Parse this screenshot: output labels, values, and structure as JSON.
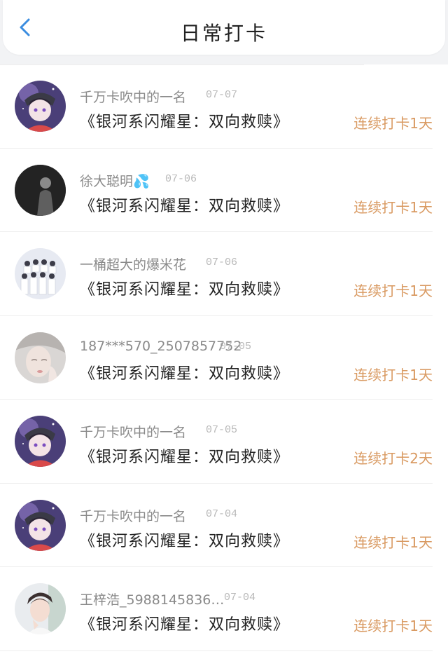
{
  "header": {
    "title": "日常打卡",
    "back_icon": "chevron-left-icon",
    "accent_color": "#3b8de0"
  },
  "checkins": [
    {
      "user": "千万卡吹中的一名",
      "date": "07-07",
      "book": "《银河系闪耀星：双向救赎》",
      "streak": "连续打卡1天",
      "avatar": "anime-boy-avatar"
    },
    {
      "user": "徐大聪明💦",
      "date": "07-06",
      "book": "《银河系闪耀星：双向救赎》",
      "streak": "连续打卡1天",
      "avatar": "dark-silhouette-avatar"
    },
    {
      "user": "一桶超大的爆米花",
      "date": "07-06",
      "book": "《银河系闪耀星：双向救赎》",
      "streak": "连续打卡1天",
      "avatar": "group-photo-avatar"
    },
    {
      "user": "187***570_2507857752",
      "date": "07-05",
      "book": "《银河系闪耀星：双向救赎》",
      "streak": "连续打卡1天",
      "avatar": "pale-face-avatar"
    },
    {
      "user": "千万卡吹中的一名",
      "date": "07-05",
      "book": "《银河系闪耀星：双向救赎》",
      "streak": "连续打卡2天",
      "avatar": "anime-boy-avatar"
    },
    {
      "user": "千万卡吹中的一名",
      "date": "07-04",
      "book": "《银河系闪耀星：双向救赎》",
      "streak": "连续打卡1天",
      "avatar": "anime-boy-avatar"
    },
    {
      "user": "王梓浩_5988145836…",
      "date": "07-04",
      "book": "《银河系闪耀星：双向救赎》",
      "streak": "连续打卡1天",
      "avatar": "portrait-photo-avatar"
    }
  ]
}
